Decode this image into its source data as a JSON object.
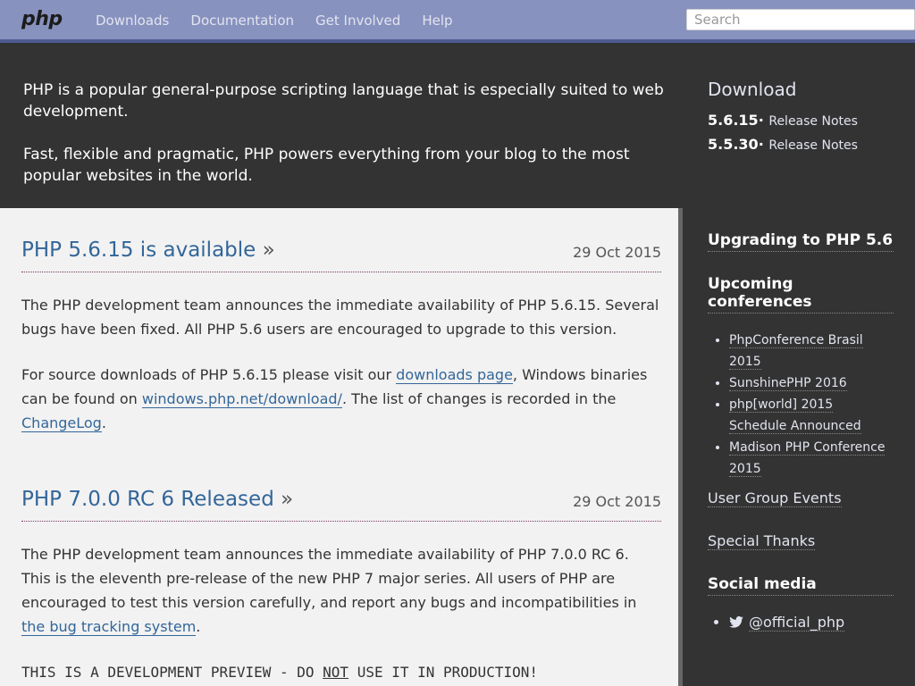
{
  "nav": {
    "logo": "php",
    "links": [
      "Downloads",
      "Documentation",
      "Get Involved",
      "Help"
    ],
    "search_placeholder": "Search"
  },
  "intro": {
    "line1": "PHP is a popular general-purpose scripting language that is especially suited to web development.",
    "line2": "Fast, flexible and pragmatic, PHP powers everything from your blog to the most popular websites in the world."
  },
  "download": {
    "heading": "Download",
    "releases": [
      {
        "version": "5.6.15",
        "sep": "·",
        "notes": "Release Notes"
      },
      {
        "version": "5.5.30",
        "sep": "·",
        "notes": "Release Notes"
      }
    ]
  },
  "news": [
    {
      "title": "PHP 5.6.15 is available",
      "raquo": "»",
      "date": "29 Oct 2015",
      "p1": "The PHP development team announces the immediate availability of PHP 5.6.15. Several bugs have been fixed. All PHP 5.6 users are encouraged to upgrade to this version.",
      "p2_a": "For source downloads of PHP 5.6.15 please visit our ",
      "p2_link1": "downloads page",
      "p2_b": ", Windows binaries can be found on ",
      "p2_link2": "windows.php.net/download/",
      "p2_c": ". The list of changes is recorded in the ",
      "p2_link3": "ChangeLog",
      "p2_d": "."
    },
    {
      "title": "PHP 7.0.0 RC 6 Released",
      "raquo": "»",
      "date": "29 Oct 2015",
      "p1_a": "The PHP development team announces the immediate availability of PHP 7.0.0 RC 6. This is the eleventh pre-release of the new PHP 7 major series. All users of PHP are encouraged to test this version carefully, and report any bugs and incompatibilities in ",
      "p1_link": "the bug tracking system",
      "p1_b": ".",
      "mono_a": "THIS IS A DEVELOPMENT PREVIEW - DO ",
      "mono_not": "NOT",
      "mono_b": " USE IT IN PRODUCTION!"
    }
  ],
  "sidebar": {
    "upgrading": "Upgrading to PHP 5.6",
    "conferences_heading": "Upcoming conferences",
    "conferences": [
      "PhpConference Brasil 2015",
      "SunshinePHP 2016",
      "php[world] 2015 Schedule Announced",
      "Madison PHP Conference 2015"
    ],
    "user_group": "User Group Events",
    "thanks": "Special Thanks",
    "social_heading": "Social media",
    "twitter": "@official_php",
    "twitter_icon": "twitter-icon"
  }
}
